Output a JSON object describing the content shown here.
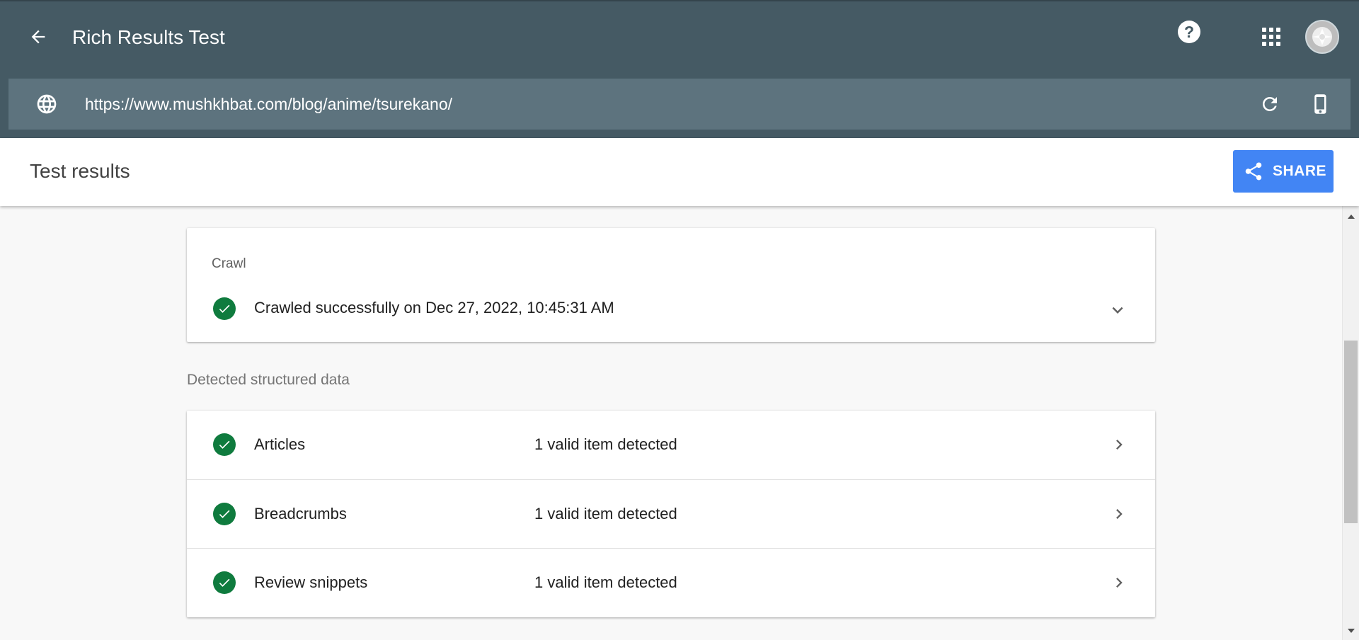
{
  "app": {
    "title": "Rich Results Test",
    "help_glyph": "?",
    "back_icon": "arrow-back-icon",
    "apps_icon": "apps-grid-icon",
    "avatar_icon": "account-avatar"
  },
  "urlbar": {
    "url": "https://www.mushkhbat.com/blog/anime/tsurekano/",
    "globe_icon": "globe-icon",
    "reload_icon": "reload-icon",
    "device_icon": "smartphone-icon"
  },
  "results": {
    "title": "Test results",
    "share_label": "SHARE",
    "share_color": "#4285f4"
  },
  "crawl": {
    "label": "Crawl",
    "status": "Crawled successfully on Dec 27, 2022, 10:45:31 AM",
    "status_color": "#0f7b3e"
  },
  "structured_data": {
    "section_label": "Detected structured data",
    "items": [
      {
        "name": "Articles",
        "status": "1 valid item detected"
      },
      {
        "name": "Breadcrumbs",
        "status": "1 valid item detected"
      },
      {
        "name": "Review snippets",
        "status": "1 valid item detected"
      }
    ]
  },
  "colors": {
    "header_bg": "#455a64",
    "urlbar_bg": "#5d737e",
    "valid_green": "#0f7b3e"
  }
}
